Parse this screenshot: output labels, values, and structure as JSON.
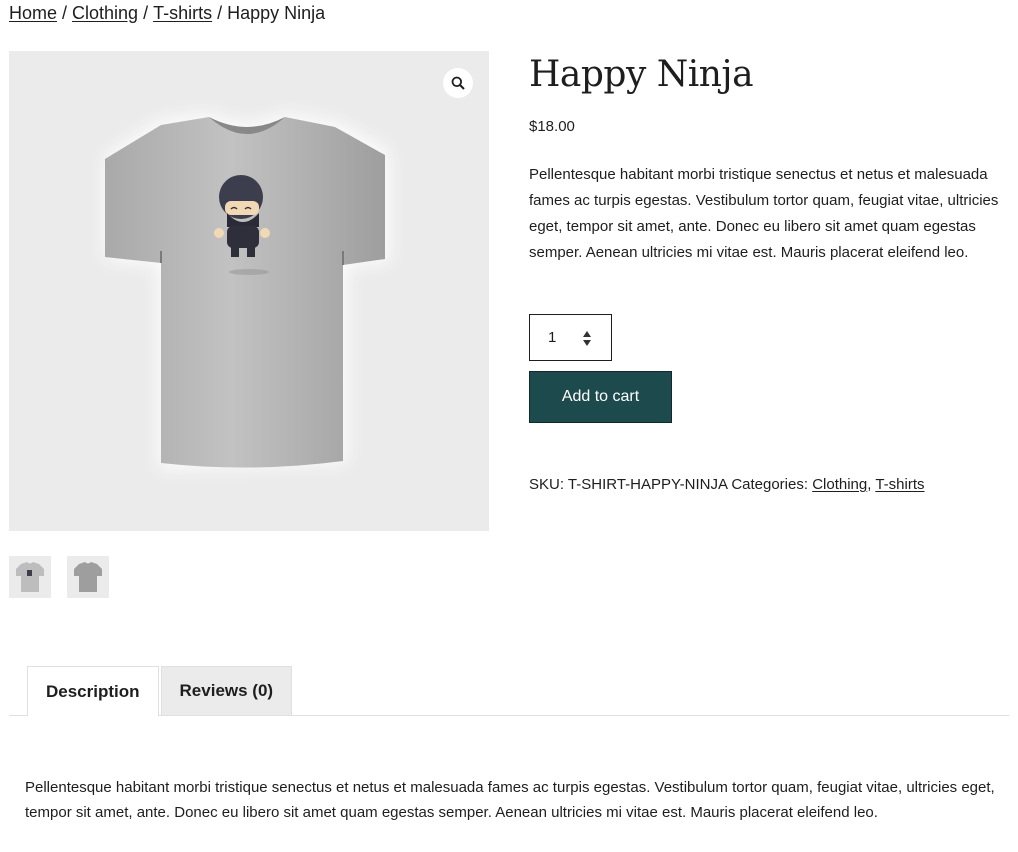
{
  "breadcrumb": {
    "items": [
      "Home",
      "Clothing",
      "T-shirts"
    ],
    "separator": "/",
    "current": "Happy Ninja"
  },
  "gallery": {
    "zoom_icon": "magnifier-icon",
    "thumbnail_count": 2,
    "background": "#ebebeb"
  },
  "product": {
    "title": "Happy Ninja",
    "price": "$18.00",
    "short_description": "Pellentesque habitant morbi tristique senectus et netus et malesuada fames ac turpis egestas. Vestibulum tortor quam, feugiat vitae, ultricies eget, tempor sit amet, ante. Donec eu libero sit amet quam egestas semper. Aenean ultricies mi vitae est. Mauris placerat eleifend leo.",
    "quantity": "1",
    "add_to_cart_label": "Add to cart",
    "sku_label": "SKU:",
    "sku": "T-SHIRT-HAPPY-NINJA",
    "categories_label": "Categories:",
    "categories": [
      "Clothing",
      "T-shirts"
    ],
    "categories_separator": ","
  },
  "tabs": {
    "items": [
      "Description",
      "Reviews (0)"
    ],
    "active": "Description"
  },
  "long_description": "Pellentesque habitant morbi tristique senectus et netus et malesuada fames ac turpis egestas. Vestibulum tortor quam, feugiat vitae, ultricies eget, tempor sit amet, ante. Donec eu libero sit amet quam egestas semper. Aenean ultricies mi vitae est. Mauris placerat eleifend leo.",
  "colors": {
    "button_bg": "#1d4a4d",
    "text": "#1e1e1e",
    "tab_inactive_bg": "#ebebeb"
  }
}
